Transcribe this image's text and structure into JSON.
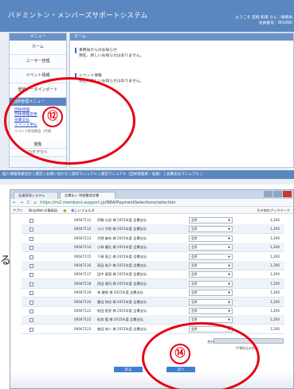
{
  "top": {
    "app_title": "バドミントン・メンバーズサポートシステム",
    "welcome_line1": "ようこそ 宮崎 和美 さん（事務局",
    "welcome_line2": "会員番号：001890",
    "menu": {
      "header": "メニュー",
      "items": [
        "ホーム",
        "ユーザー管理",
        "イベント情報",
        "登録データインポート"
      ],
      "group_header": "団体管理メニュー",
      "group_links": [
        "団体情報",
        "団体情報変更",
        "会費支払",
        "イベント申込"
      ],
      "group_extra": "イベント状況照会（代理",
      "after_items": [
        "閲覧",
        "ログアウト"
      ]
    },
    "home": {
      "header": "ホーム",
      "notice1_title": "事務局からのお知らせ",
      "notice1_body": "現在、新しいお知らせはありません。",
      "notice2_title": "イベント情報",
      "notice2_body": "現在、新しいお知らせはありません。"
    },
    "bottom_links": "個人情報等規合計 | 運営 | お問い合わせ | 操作マニュアル | 運営マニュアル（団体管理者・会員） | 会費支払マニュアル |",
    "callout": "⑫"
  },
  "bottom": {
    "tabs": [
      "会員登録システム",
      "会費払い 明細書請求書"
    ],
    "url_host": "https://m2.members-support.jp",
    "url_path": "/NBA/PaymentSelections/selection",
    "bookmarks": [
      "アプリ",
      "NinjaNet の事務局",
      "新しいフォルダ"
    ],
    "other_bookmarks": "その他のブックマーク",
    "rows": [
      {
        "num": "00047111",
        "name": "伊藤 礼造 様 2015年度 会費支払",
        "select": "会費",
        "amount": "1,200"
      },
      {
        "num": "00047112",
        "name": "小川 大地 様 2015年度 会費支払",
        "select": "会費",
        "amount": "1,200"
      },
      {
        "num": "00047113",
        "name": "大野 麻衣 様 2015年度 会費支払",
        "select": "会費",
        "amount": "1,200"
      },
      {
        "num": "00047114",
        "name": "小林 優太 様 2015年度 会費支払",
        "select": "会費",
        "amount": "1,200"
      },
      {
        "num": "00047115",
        "name": "下崎 直之 様 2015年度 会費支払",
        "select": "会費",
        "amount": "1,200"
      },
      {
        "num": "00047116",
        "name": "高田 裕子 様 2015年度 会費支払",
        "select": "会費",
        "amount": "1,200"
      },
      {
        "num": "00047117",
        "name": "田中 真理 様 2015年度 会費支払",
        "select": "会費",
        "amount": "1,200"
      },
      {
        "num": "00047118",
        "name": "西田 雅司 様 2015年度 会費支払",
        "select": "会費",
        "amount": "1,200"
      },
      {
        "num": "00047119",
        "name": "林 健郎 様 2015年度 会費支払",
        "select": "会費",
        "amount": "1,200"
      },
      {
        "num": "00047120",
        "name": "藤田 和也 様 2015年度 会費支払",
        "select": "会費",
        "amount": "1,200"
      },
      {
        "num": "00047121",
        "name": "前田 智恵 様 2015年度 会費支払",
        "select": "会費",
        "amount": "1,200"
      },
      {
        "num": "00047122",
        "name": "松本 隆 様 2015年度 会費支払",
        "select": "会費",
        "amount": "1,200"
      },
      {
        "num": "00047123",
        "name": "森田 修二 様 2015年度 会費支払",
        "select": "会費",
        "amount": "1,200"
      }
    ],
    "total_label": "合計",
    "total_note": "（手数料込み合計）",
    "buttons": [
      "戻る",
      "次へ"
    ],
    "callout": "⑭"
  },
  "side_glyph": "る",
  "colors": {
    "accent": "#5b87c1",
    "callout": "#e60012",
    "button": "#3f7fd1"
  }
}
